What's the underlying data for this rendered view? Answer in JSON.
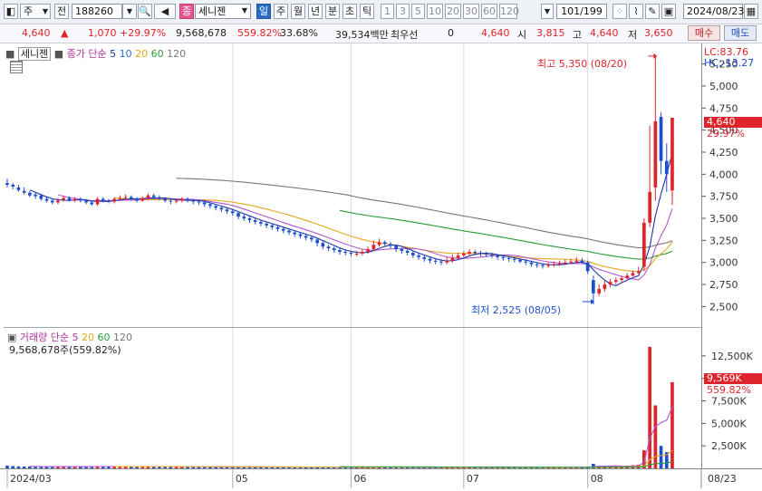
{
  "toolbar": {
    "market_label": "주",
    "period_label": "전",
    "stock_code": "188260",
    "stock_type_badge": "종",
    "stock_name": "세니젠",
    "timeframes": [
      "일",
      "주",
      "월",
      "년",
      "분",
      "초",
      "틱"
    ],
    "active_timeframe": "일",
    "intervals": [
      "1",
      "3",
      "5",
      "10",
      "20",
      "30",
      "60",
      "120"
    ],
    "page_counter": "101/199",
    "date": "2024/08/23"
  },
  "quote": {
    "price": "4,640",
    "change": "1,070",
    "change_pct": "+29.97%",
    "volume": "9,568,678",
    "volume_ratio": "559.82%",
    "turnover": "33.68%",
    "trade_value": "39,534백만",
    "pref_label": "최우선",
    "pref_value": "0",
    "pref_price": "4,640",
    "open_label": "시",
    "open": "3,815",
    "high_label": "고",
    "high": "4,640",
    "low_label": "저",
    "low": "3,650",
    "buy_label": "매수",
    "sell_label": "매도"
  },
  "price_legend": {
    "name": "세니젠",
    "series_label": "종가 단순",
    "ma_periods": [
      "5",
      "10",
      "20",
      "60",
      "120"
    ],
    "lc": "LC:83.76",
    "hc": "HC:-13.27"
  },
  "price_annotations": {
    "high_note": "최고 5,350 (08/20)",
    "low_note": "최저 2,525 (08/05)",
    "last_price_tag": "4,640",
    "last_pct_tag": "29.97%"
  },
  "volume_legend": {
    "name": "거래량",
    "series_label": "단순",
    "ma_periods": [
      "5",
      "20",
      "60",
      "120"
    ],
    "current": "9,568,678주(559.82%)",
    "last_volume_tag": "9,569K",
    "last_pct_tag": "559.82%"
  },
  "colors": {
    "up": "#e0242b",
    "down": "#1f4fd1",
    "ma5": "#2233aa",
    "ma10": "#b05ad0",
    "ma20": "#e6a81e",
    "ma60": "#2a9a3a",
    "ma120": "#777777"
  },
  "chart_data": {
    "type": "candlestick",
    "price_axis": {
      "range": [
        2350,
        5400
      ],
      "ticks": [
        "5,250",
        "5,000",
        "4,750",
        "4,500",
        "4,250",
        "4,000",
        "3,750",
        "3,500",
        "3,250",
        "3,000",
        "2,750",
        "2,500"
      ],
      "tick_values": [
        5250,
        5000,
        4750,
        4500,
        4250,
        4000,
        3750,
        3500,
        3250,
        3000,
        2750,
        2500
      ]
    },
    "volume_axis": {
      "range": [
        0,
        15000
      ],
      "ticks": [
        "12,500K",
        "10,000K",
        "7,500K",
        "5,000K",
        "2,500K"
      ],
      "tick_values": [
        12500,
        10000,
        7500,
        5000,
        2500
      ]
    },
    "month_labels": [
      {
        "label": "2024/03",
        "index": 0
      },
      {
        "label": "05",
        "index": 40
      },
      {
        "label": "06",
        "index": 61
      },
      {
        "label": "07",
        "index": 81
      },
      {
        "label": "08",
        "index": 103
      }
    ],
    "last_date_label": "08/23",
    "ohlc_close": [
      3880,
      3860,
      3820,
      3790,
      3760,
      3750,
      3720,
      3700,
      3680,
      3700,
      3730,
      3710,
      3720,
      3700,
      3680,
      3660,
      3720,
      3700,
      3690,
      3720,
      3730,
      3740,
      3720,
      3700,
      3730,
      3760,
      3740,
      3720,
      3700,
      3690,
      3700,
      3720,
      3710,
      3690,
      3680,
      3660,
      3640,
      3620,
      3600,
      3580,
      3560,
      3520,
      3500,
      3480,
      3460,
      3440,
      3420,
      3400,
      3380,
      3360,
      3340,
      3320,
      3300,
      3280,
      3260,
      3220,
      3180,
      3160,
      3140,
      3120,
      3110,
      3100,
      3100,
      3120,
      3150,
      3200,
      3230,
      3210,
      3190,
      3150,
      3130,
      3110,
      3080,
      3060,
      3040,
      3020,
      3010,
      3000,
      3020,
      3050,
      3080,
      3100,
      3120,
      3110,
      3100,
      3090,
      3080,
      3060,
      3050,
      3040,
      3030,
      3010,
      3000,
      2980,
      2970,
      2960,
      2970,
      2980,
      2990,
      3000,
      3010,
      3020,
      3000,
      2900,
      2650,
      2700,
      2750,
      2780,
      2800,
      2820,
      2850,
      2880,
      2900,
      3450,
      3800,
      4600,
      4150,
      4000,
      4640
    ],
    "ohlc_open": [
      3900,
      3880,
      3850,
      3810,
      3790,
      3770,
      3760,
      3720,
      3700,
      3680,
      3710,
      3730,
      3700,
      3720,
      3700,
      3680,
      3660,
      3720,
      3700,
      3690,
      3720,
      3730,
      3740,
      3720,
      3700,
      3730,
      3760,
      3740,
      3720,
      3700,
      3690,
      3700,
      3720,
      3710,
      3690,
      3680,
      3660,
      3640,
      3620,
      3600,
      3580,
      3560,
      3520,
      3500,
      3480,
      3460,
      3440,
      3420,
      3400,
      3380,
      3360,
      3340,
      3320,
      3300,
      3280,
      3260,
      3220,
      3180,
      3160,
      3140,
      3120,
      3110,
      3090,
      3100,
      3120,
      3150,
      3200,
      3230,
      3210,
      3190,
      3150,
      3130,
      3110,
      3080,
      3060,
      3040,
      3020,
      3010,
      3000,
      3020,
      3050,
      3080,
      3100,
      3120,
      3110,
      3100,
      3090,
      3080,
      3060,
      3050,
      3040,
      3030,
      3010,
      3000,
      2980,
      2970,
      2960,
      2970,
      2980,
      2990,
      3000,
      3010,
      3020,
      3000,
      2800,
      2650,
      2700,
      2750,
      2780,
      2800,
      2820,
      2850,
      2880,
      2950,
      3450,
      3850,
      4650,
      4150,
      3815
    ],
    "high": [
      3950,
      3900,
      3880,
      3850,
      3810,
      3790,
      3780,
      3740,
      3720,
      3730,
      3760,
      3750,
      3740,
      3740,
      3720,
      3700,
      3740,
      3740,
      3720,
      3740,
      3760,
      3770,
      3760,
      3740,
      3750,
      3780,
      3780,
      3760,
      3740,
      3720,
      3720,
      3740,
      3740,
      3720,
      3710,
      3700,
      3680,
      3660,
      3640,
      3620,
      3600,
      3580,
      3550,
      3520,
      3500,
      3480,
      3460,
      3440,
      3420,
      3400,
      3380,
      3360,
      3340,
      3320,
      3300,
      3280,
      3240,
      3200,
      3180,
      3160,
      3150,
      3130,
      3130,
      3150,
      3180,
      3250,
      3270,
      3250,
      3230,
      3200,
      3170,
      3150,
      3130,
      3100,
      3080,
      3060,
      3050,
      3040,
      3060,
      3090,
      3110,
      3130,
      3150,
      3140,
      3130,
      3120,
      3110,
      3090,
      3080,
      3070,
      3060,
      3050,
      3040,
      3020,
      3000,
      2990,
      3000,
      3010,
      3020,
      3030,
      3040,
      3060,
      3050,
      3020,
      2850,
      2750,
      2790,
      2810,
      2830,
      2850,
      2880,
      2910,
      2950,
      3500,
      4550,
      5350,
      4700,
      4350,
      4640
    ],
    "low": [
      3850,
      3830,
      3800,
      3770,
      3740,
      3720,
      3700,
      3680,
      3660,
      3660,
      3690,
      3690,
      3680,
      3680,
      3660,
      3640,
      3640,
      3680,
      3670,
      3670,
      3700,
      3710,
      3700,
      3680,
      3690,
      3710,
      3720,
      3700,
      3680,
      3660,
      3670,
      3680,
      3680,
      3660,
      3650,
      3630,
      3610,
      3590,
      3570,
      3550,
      3530,
      3490,
      3470,
      3450,
      3430,
      3410,
      3390,
      3370,
      3350,
      3330,
      3310,
      3290,
      3270,
      3250,
      3230,
      3180,
      3150,
      3130,
      3110,
      3090,
      3080,
      3070,
      3070,
      3080,
      3100,
      3130,
      3180,
      3180,
      3160,
      3120,
      3100,
      3080,
      3050,
      3030,
      3010,
      2990,
      2980,
      2970,
      2980,
      3000,
      3040,
      3060,
      3080,
      3080,
      3070,
      3060,
      3050,
      3030,
      3020,
      3010,
      3000,
      2990,
      2970,
      2950,
      2940,
      2930,
      2940,
      2950,
      2960,
      2970,
      2980,
      2990,
      2980,
      2870,
      2525,
      2620,
      2670,
      2720,
      2750,
      2780,
      2810,
      2840,
      2870,
      2900,
      3400,
      3700,
      4000,
      3800,
      3650
    ],
    "volume_k": [
      300,
      250,
      220,
      200,
      210,
      190,
      180,
      200,
      210,
      190,
      200,
      180,
      190,
      200,
      210,
      190,
      220,
      200,
      190,
      200,
      210,
      220,
      200,
      190,
      200,
      220,
      210,
      200,
      190,
      180,
      190,
      200,
      190,
      180,
      170,
      180,
      170,
      160,
      170,
      160,
      170,
      180,
      170,
      160,
      150,
      160,
      150,
      140,
      150,
      140,
      130,
      140,
      130,
      140,
      130,
      150,
      140,
      130,
      120,
      130,
      120,
      110,
      120,
      130,
      140,
      170,
      160,
      150,
      140,
      130,
      120,
      110,
      120,
      110,
      100,
      110,
      100,
      110,
      120,
      130,
      140,
      130,
      120,
      110,
      100,
      110,
      100,
      110,
      100,
      90,
      100,
      90,
      100,
      110,
      100,
      90,
      100,
      110,
      100,
      110,
      100,
      120,
      110,
      160,
      500,
      250,
      200,
      220,
      230,
      250,
      300,
      350,
      400,
      2000,
      13500,
      7000,
      2500,
      1800,
      9569
    ],
    "ma5": [],
    "note_ma": "moving averages computed from closes"
  }
}
